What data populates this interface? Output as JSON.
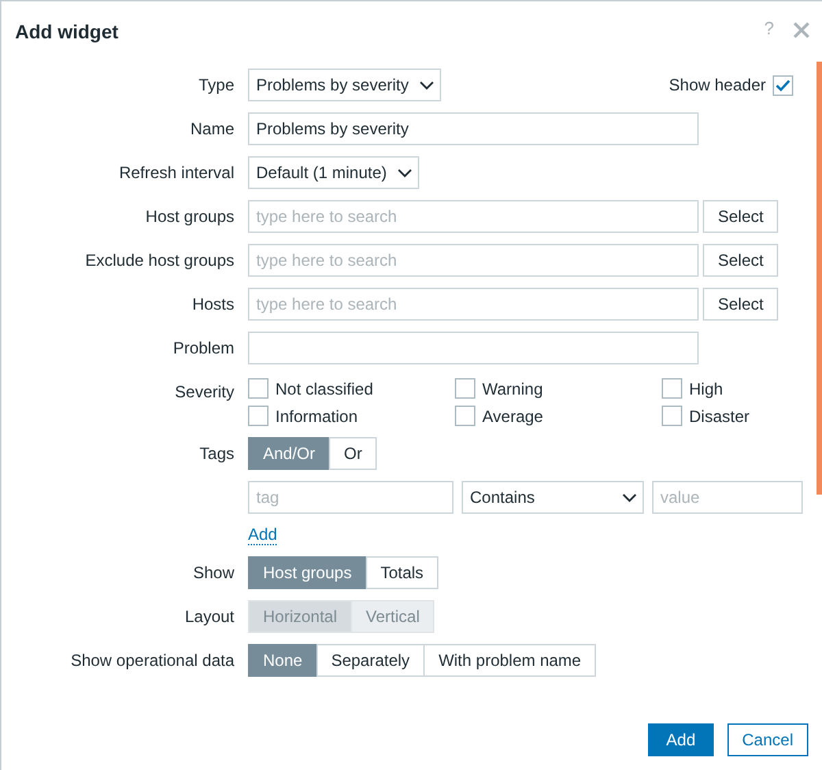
{
  "dialog": {
    "title": "Add widget",
    "help": "?"
  },
  "fields": [
    {
      "kind": "select",
      "label": "Type",
      "value": "Problems by severity",
      "show_header": {
        "label": "Show header",
        "checked": true
      }
    },
    {
      "kind": "text",
      "label": "Name",
      "value": "Problems by severity"
    },
    {
      "kind": "select",
      "label": "Refresh interval",
      "value": "Default (1 minute)"
    },
    {
      "kind": "multiselect",
      "label": "Host groups",
      "placeholder": "type here to search",
      "button": "Select"
    },
    {
      "kind": "multiselect",
      "label": "Exclude host groups",
      "placeholder": "type here to search",
      "button": "Select"
    },
    {
      "kind": "multiselect",
      "label": "Hosts",
      "placeholder": "type here to search",
      "button": "Select"
    },
    {
      "kind": "text",
      "label": "Problem"
    },
    {
      "kind": "checkboxes",
      "label": "Severity",
      "items": [
        {
          "label": "Not classified",
          "checked": false
        },
        {
          "label": "Warning",
          "checked": false
        },
        {
          "label": "High",
          "checked": false
        },
        {
          "label": "Information",
          "checked": false
        },
        {
          "label": "Average",
          "checked": false
        },
        {
          "label": "Disaster",
          "checked": false
        }
      ]
    },
    {
      "kind": "segmented",
      "label": "Tags",
      "disabled": false,
      "options": [
        {
          "label": "And/Or",
          "selected": true
        },
        {
          "label": "Or",
          "selected": false
        }
      ],
      "tag_filter": {
        "tag_placeholder": "tag",
        "operator": "Contains",
        "value_placeholder": "value"
      },
      "add_link": "Add"
    },
    {
      "kind": "segmented",
      "label": "Show",
      "disabled": false,
      "options": [
        {
          "label": "Host groups",
          "selected": true
        },
        {
          "label": "Totals",
          "selected": false
        }
      ]
    },
    {
      "kind": "segmented",
      "label": "Layout",
      "disabled": true,
      "options": [
        {
          "label": "Horizontal",
          "selected": true
        },
        {
          "label": "Vertical",
          "selected": false
        }
      ]
    },
    {
      "kind": "segmented",
      "label": "Show operational data",
      "disabled": false,
      "options": [
        {
          "label": "None",
          "selected": true
        },
        {
          "label": "Separately",
          "selected": false
        },
        {
          "label": "With problem name",
          "selected": false
        }
      ]
    }
  ],
  "buttons": [
    {
      "label": "Add",
      "primary": true
    },
    {
      "label": "Cancel",
      "primary": false
    }
  ]
}
